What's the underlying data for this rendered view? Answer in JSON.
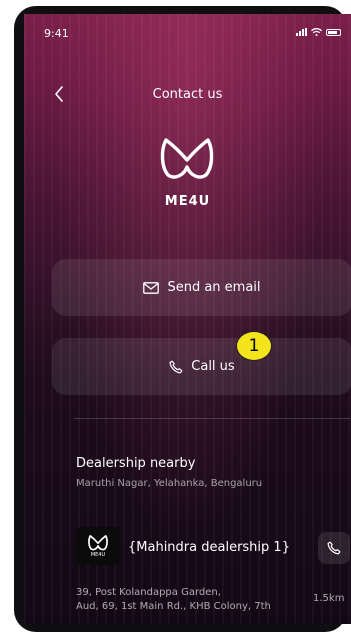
{
  "status_bar": {
    "time": "9:41"
  },
  "header": {
    "back_icon": "chevron-left-icon",
    "title": "Contact us"
  },
  "brand": {
    "logo_icon": "me4u-logo-icon",
    "name": "ME4U"
  },
  "actions": {
    "email": {
      "icon": "mail-icon",
      "label": "Send an email"
    },
    "call": {
      "icon": "phone-icon",
      "label": "Call us"
    }
  },
  "annotation": {
    "badge": "1",
    "color": "#f4e41c"
  },
  "dealership": {
    "title": "Dealership nearby",
    "location": "Maruthi Nagar, Yelahanka, Bengaluru",
    "item": {
      "logo_text": "ME4U",
      "name": "{Mahindra dealership 1}",
      "address_line1": "39, Post Kolandappa Garden,",
      "address_line2": "Aud, 69, 1st Main Rd., KHB Colony, 7th",
      "distance": "1.5km",
      "call_icon": "phone-icon"
    }
  },
  "colors": {
    "gradient_top": "#7a1f4a",
    "gradient_bottom": "#130815"
  }
}
